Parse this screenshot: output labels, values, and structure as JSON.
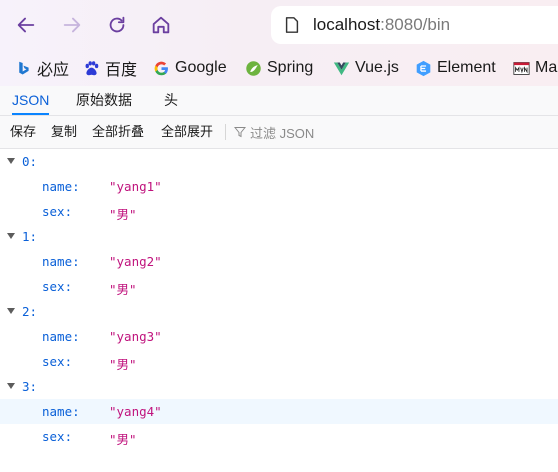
{
  "browser": {
    "url": {
      "host": "localhost",
      "rest": ":8080/bin"
    },
    "bookmarks": [
      {
        "label": "必应",
        "icon": "bing-icon"
      },
      {
        "label": "百度",
        "icon": "baidu-icon"
      },
      {
        "label": "Google",
        "icon": "google-icon"
      },
      {
        "label": "Spring",
        "icon": "spring-icon"
      },
      {
        "label": "Vue.js",
        "icon": "vue-icon"
      },
      {
        "label": "Element",
        "icon": "element-icon"
      },
      {
        "label": "Ma",
        "icon": "maven-icon"
      }
    ]
  },
  "viewer": {
    "tabs": [
      "JSON",
      "原始数据",
      "头"
    ],
    "active_tab": "JSON",
    "toolbar": {
      "save": "保存",
      "copy": "复制",
      "collapse_all": "全部折叠",
      "expand_all": "全部展开",
      "filter_placeholder": "过滤 JSON"
    },
    "items": [
      {
        "index": "0:",
        "name_key": "name:",
        "name_value": "\"yang1\"",
        "sex_key": "sex:",
        "sex_value": "\"男\""
      },
      {
        "index": "1:",
        "name_key": "name:",
        "name_value": "\"yang2\"",
        "sex_key": "sex:",
        "sex_value": "\"男\""
      },
      {
        "index": "2:",
        "name_key": "name:",
        "name_value": "\"yang3\"",
        "sex_key": "sex:",
        "sex_value": "\"男\""
      },
      {
        "index": "3:",
        "name_key": "name:",
        "name_value": "\"yang4\"",
        "sex_key": "sex:",
        "sex_value": "\"男\""
      }
    ]
  },
  "colors": {
    "accent": "#0a84ff",
    "key": "#0a60d8",
    "string": "#c0137d"
  }
}
